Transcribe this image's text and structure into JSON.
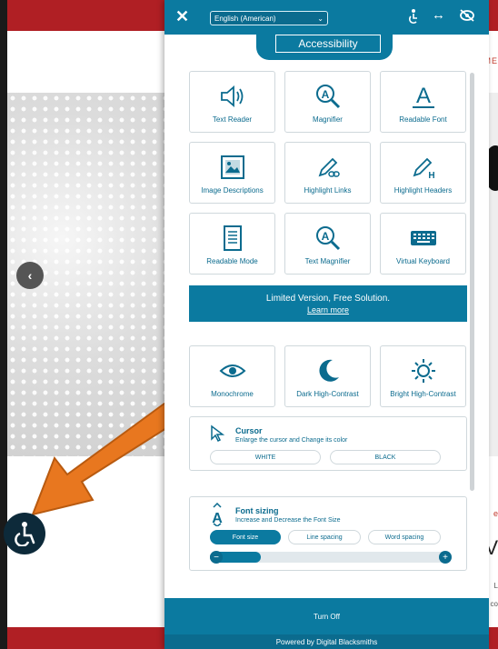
{
  "panel": {
    "close_icon": "close-icon",
    "language": "English (American)",
    "header_icons": [
      "accessibility-person-icon",
      "resize-arrows-icon",
      "hide-eye-icon"
    ],
    "tab_label": "Accessibility",
    "tools": [
      {
        "label": "Text Reader",
        "icon": "speaker-icon"
      },
      {
        "label": "Magnifier",
        "icon": "magnifier-icon"
      },
      {
        "label": "Readable Font",
        "icon": "font-icon"
      },
      {
        "label": "Image Descriptions",
        "icon": "image-icon"
      },
      {
        "label": "Highlight Links",
        "icon": "pen-link-icon"
      },
      {
        "label": "Highlight Headers",
        "icon": "pen-header-icon"
      },
      {
        "label": "Readable Mode",
        "icon": "document-icon"
      },
      {
        "label": "Text Magnifier",
        "icon": "text-magnifier-icon"
      },
      {
        "label": "Virtual Keyboard",
        "icon": "keyboard-icon"
      }
    ],
    "banner": {
      "title": "Limited Version, Free Solution.",
      "link": "Learn more"
    },
    "contrast": [
      {
        "label": "Monochrome",
        "icon": "eye-icon"
      },
      {
        "label": "Dark High-Contrast",
        "icon": "moon-icon"
      },
      {
        "label": "Bright High-Contrast",
        "icon": "sun-icon"
      }
    ],
    "cursor": {
      "title": "Cursor",
      "desc": "Enlarge the cursor and Change its color",
      "options": [
        "WHITE",
        "BLACK"
      ]
    },
    "font_sizing": {
      "title": "Font sizing",
      "desc": "Increase and Decrease the Font Size",
      "tabs": [
        "Font size",
        "Line spacing",
        "Word spacing"
      ],
      "active_tab": "Font size",
      "level": 0.16
    },
    "turn_off": "Turn Off",
    "powered_by": "Powered by Digital Blacksmiths"
  },
  "site": {
    "right_text_top": "ME",
    "right_text_mid": "e",
    "big_char": "V",
    "small1": "L",
    "small2": "co"
  },
  "colors": {
    "accent": "#0b7aa0",
    "accent_dark": "#0b6b8e",
    "site_red": "#b01f24",
    "arrow": "#e8771f"
  }
}
